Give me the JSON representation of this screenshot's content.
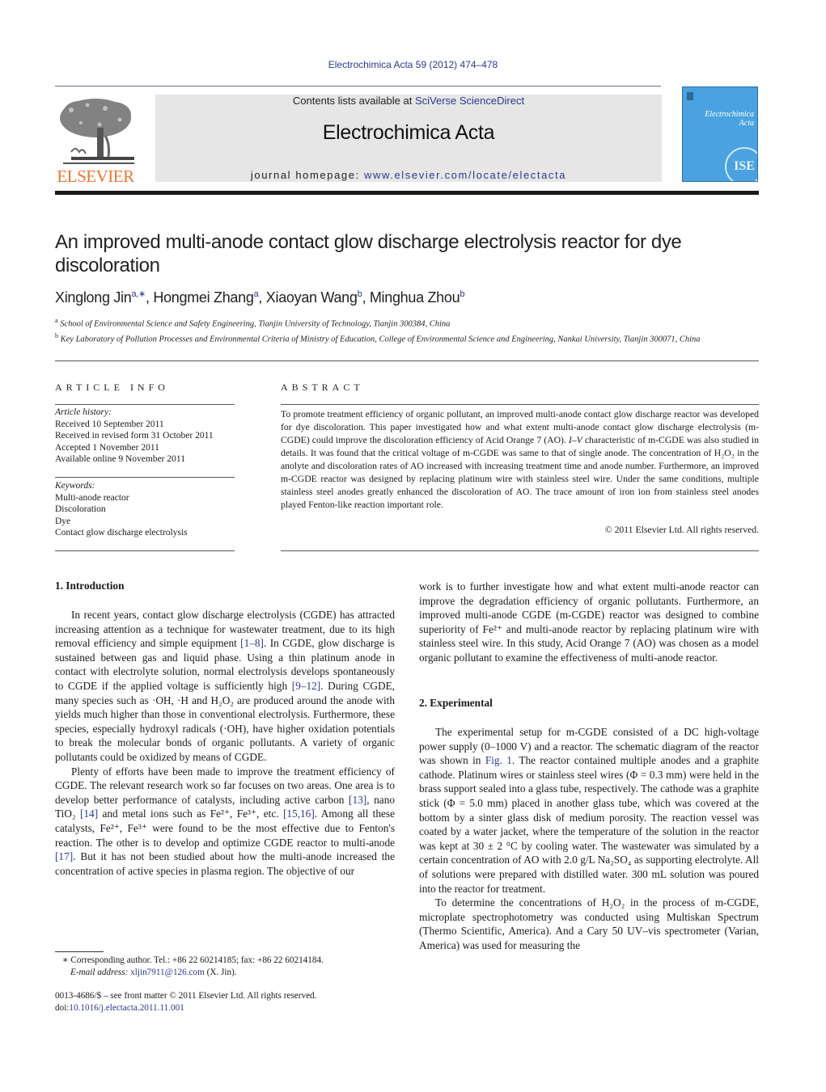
{
  "header": {
    "citation": "Electrochimica Acta 59 (2012) 474–478",
    "publisher_logo": "ELSEVIER",
    "contents_prefix": "Contents lists available at ",
    "contents_link": "SciVerse ScienceDirect",
    "journal_title": "Electrochimica Acta",
    "homepage_prefix": "journal homepage: ",
    "homepage_link": "www.elsevier.com/locate/electacta",
    "cover_title_line1": "Electrochimica",
    "cover_title_line2": "Acta",
    "cover_badge": "ISE",
    "colors": {
      "publisher_orange": "#e8772e",
      "link_blue": "#2b3a8f",
      "cover_blue": "#4aa3e0",
      "masthead_gray": "#e6e6e6"
    }
  },
  "article": {
    "title": "An improved multi-anode contact glow discharge electrolysis reactor for dye discoloration",
    "authors": [
      {
        "name": "Xinglong Jin",
        "sup": "a,∗"
      },
      {
        "name": "Hongmei Zhang",
        "sup": "a"
      },
      {
        "name": "Xiaoyan Wang",
        "sup": "b"
      },
      {
        "name": "Minghua Zhou",
        "sup": "b"
      }
    ],
    "affiliations": [
      {
        "mark": "a",
        "text": "School of Environmental Science and Safety Engineering, Tianjin University of Technology, Tianjin 300384, China"
      },
      {
        "mark": "b",
        "text": "Key Laboratory of Pollution Processes and Environmental Criteria of Ministry of Education, College of Environmental Science and Engineering, Nankai University, Tianjin 300071, China"
      }
    ]
  },
  "article_info": {
    "heading": "ARTICLE INFO",
    "history_label": "Article history:",
    "history": [
      "Received 10 September 2011",
      "Received in revised form 31 October 2011",
      "Accepted 1 November 2011",
      "Available online 9 November 2011"
    ],
    "keywords_label": "Keywords:",
    "keywords": [
      "Multi-anode reactor",
      "Discoloration",
      "Dye",
      "Contact glow discharge electrolysis"
    ]
  },
  "abstract": {
    "heading": "ABSTRACT",
    "p1": "To promote treatment efficiency of organic pollutant, an improved multi-anode contact glow discharge reactor was developed for dye discoloration. This paper investigated how and what extent multi-anode contact glow discharge electrolysis (m-CGDE) could improve the discoloration efficiency of Acid Orange 7 (AO). ",
    "iv": "I–V",
    "p2": " characteristic of m-CGDE was also studied in details. It was found that the critical voltage of m-CGDE was same to that of single anode. The concentration of H₂O₂ in the anolyte and discoloration rates of AO increased with increasing treatment time and anode number. Furthermore, an improved m-CGDE reactor was designed by replacing platinum wire with stainless steel wire. Under the same conditions, multiple stainless steel anodes greatly enhanced the discoloration of AO. The trace amount of iron ion from stainless steel anodes played Fenton-like reaction important role.",
    "copyright": "© 2011 Elsevier Ltd. All rights reserved."
  },
  "introduction": {
    "title": "1.  Introduction",
    "p1_a": "In recent years, contact glow discharge electrolysis (CGDE) has attracted increasing attention as a technique for wastewater treatment, due to its high removal efficiency and simple equipment ",
    "ref1": "[1–8]",
    "p1_b": ". In CGDE, glow discharge is sustained between gas and liquid phase. Using a thin platinum anode in contact with electrolyte solution, normal electrolysis develops spontaneously to CGDE if the applied voltage is sufficiently high ",
    "ref2": "[9–12]",
    "p1_c": ". During CGDE, many species such as ·OH, ·H and H₂O₂ are produced around the anode with yields much higher than those in conventional electrolysis. Furthermore, these species, especially hydroxyl radicals (·OH), have higher oxidation potentials to break the molecular bonds of organic pollutants. A variety of organic pollutants could be oxidized by means of CGDE.",
    "p2_a": "Plenty of efforts have been made to improve the treatment efficiency of CGDE. The relevant research work so far focuses on two areas. One area is to develop better performance of catalysts, including active carbon ",
    "ref3": "[13]",
    "p2_b": ", nano TiO₂ ",
    "ref4": "[14]",
    "p2_c": " and metal ions such as Fe²⁺, Fe³⁺, etc. ",
    "ref5": "[15,16]",
    "p2_d": ". Among all these catalysts, Fe²⁺, Fe³⁺ were found to be the most effective due to Fenton's reaction. The other is to develop and optimize CGDE reactor to multi-anode ",
    "ref6": "[17]",
    "p2_e": ". But it has not been studied about how the multi-anode increased the concentration of active species in plasma region. The objective of our",
    "p3": "work is to further investigate how and what extent multi-anode reactor can improve the degradation efficiency of organic pollutants. Furthermore, an improved multi-anode CGDE (m-CGDE) reactor was designed to combine superiority of Fe²⁺ and multi-anode reactor by replacing platinum wire with stainless steel wire. In this study, Acid Orange 7 (AO) was chosen as a model organic pollutant to examine the effectiveness of multi-anode reactor."
  },
  "experimental": {
    "title": "2.  Experimental",
    "p1_a": "The experimental setup for m-CGDE consisted of a DC high-voltage power supply (0–1000 V) and a reactor. The schematic diagram of the reactor was shown in ",
    "fig_ref": "Fig. 1",
    "p1_b": ". The reactor contained multiple anodes and a graphite cathode. Platinum wires or stainless steel wires (Φ = 0.3 mm) were held in the brass support sealed into a glass tube, respectively. The cathode was a graphite stick (Φ = 5.0 mm) placed in another glass tube, which was covered at the bottom by a sinter glass disk of medium porosity. The reaction vessel was coated by a water jacket, where the temperature of the solution in the reactor was kept at 30 ± 2 °C by cooling water. The wastewater was simulated by a certain concentration of AO with 2.0 g/L Na₂SO₄ as supporting electrolyte. All of solutions were prepared with distilled water. 300 mL solution was poured into the reactor for treatment.",
    "p2": "To determine the concentrations of H₂O₂ in the process of m-CGDE, microplate spectrophotometry was conducted using Multiskan Spectrum (Thermo Scientific, America). And a Cary 50 UV–vis spectrometer (Varian, America) was used for measuring the"
  },
  "footnote": {
    "marker": "∗",
    "text": " Corresponding author. Tel.: +86 22 60214185; fax: +86 22 60214184.",
    "email_label": "E-mail address:",
    "email": "xljin7911@126.com",
    "email_suffix": " (X. Jin)."
  },
  "front_matter": {
    "issn_line": "0013-4686/$ – see front matter © 2011 Elsevier Ltd. All rights reserved.",
    "doi_prefix": "doi:",
    "doi": "10.1016/j.electacta.2011.11.001"
  }
}
